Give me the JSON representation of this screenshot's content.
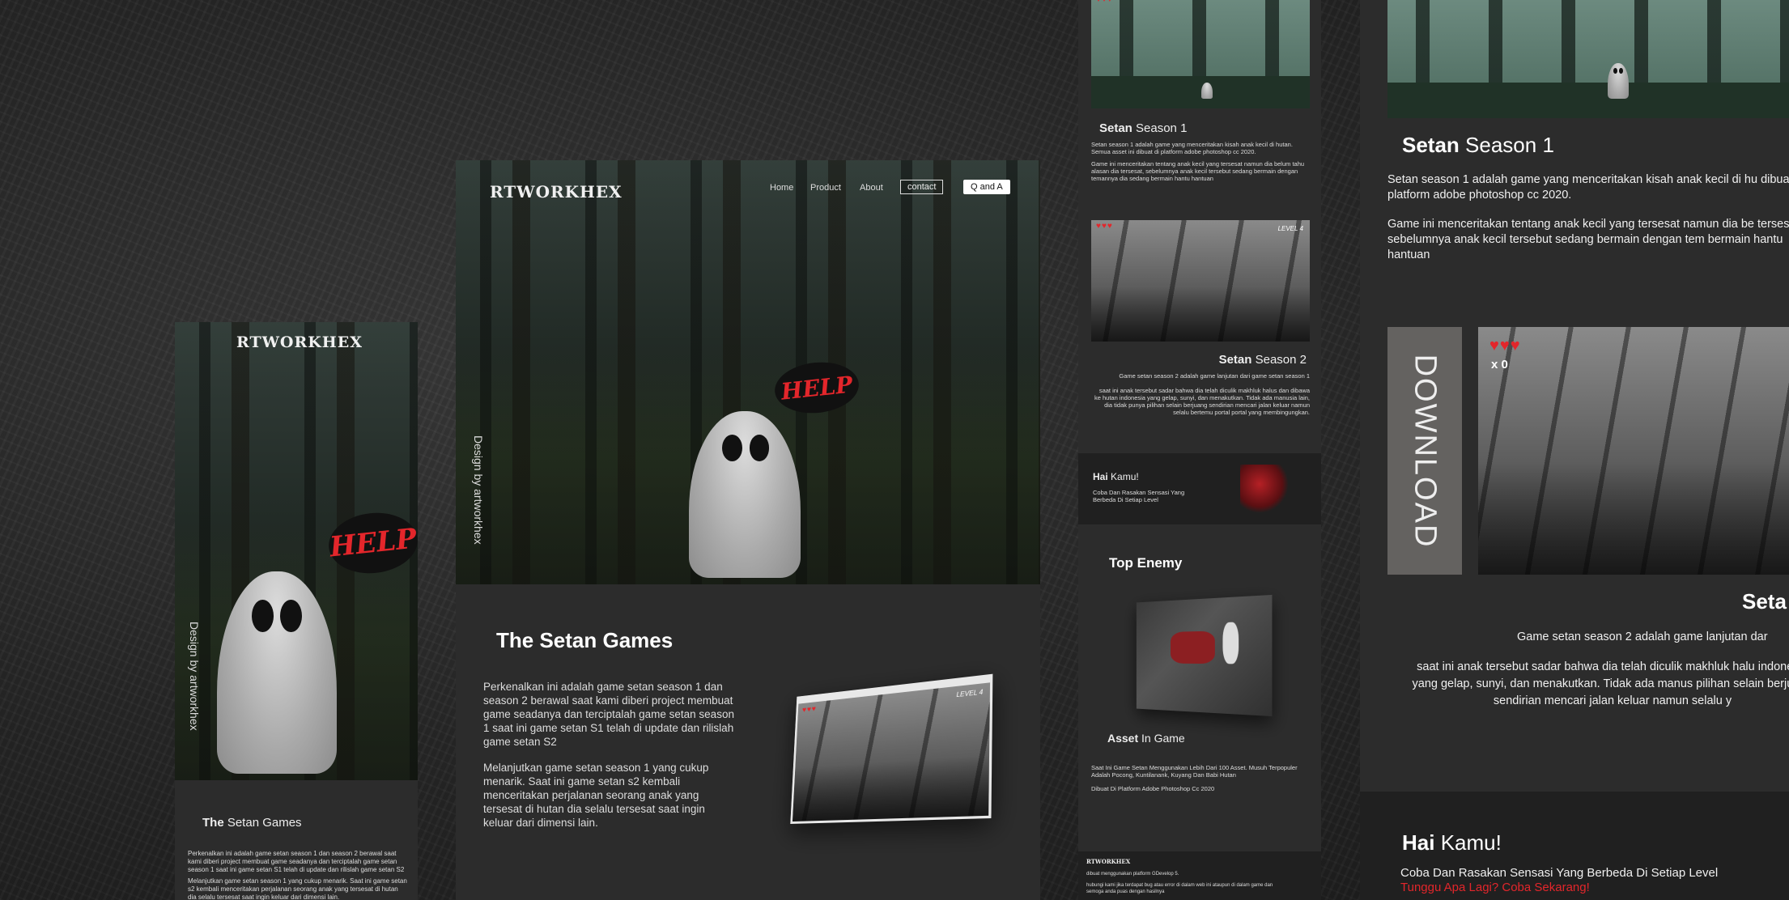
{
  "brand": {
    "logo_desktop": "RTWORKHEX",
    "logo_mobile": "RTWORKHEX",
    "logo_footer": "RTWORKHEX"
  },
  "nav": {
    "home": "Home",
    "product": "Product",
    "about": "About",
    "contact": "contact",
    "qa": "Q and A"
  },
  "hero": {
    "side_credit": "Design by artworkhex",
    "speech": "HELP"
  },
  "intro": {
    "title_bold": "The",
    "title_rest": " Setan Games",
    "title_full": "The Setan Games",
    "para1": "Perkenalkan ini adalah game setan season 1 dan season 2 berawal saat kami diberi project membuat game seadanya dan terciptalah game setan season 1 saat ini game setan S1 telah di update dan rilislah game setan S2",
    "para2": "Melanjutkan game setan season 1 yang cukup menarik. Saat ini game setan s2 kembali menceritakan perjalanan seorang anak yang tersesat di hutan dia selalu tersesat saat ingin keluar dari dimensi lain.",
    "mobile_para1": "Perkenalkan ini adalah game setan season 1 dan season 2 berawal saat kami diberi project membuat game seadanya dan terciptalah game setan season 1 saat ini game setan S1 telah di update dan rilislah game setan S2",
    "mobile_para2": "Melanjutkan game setan season 1 yang cukup menarik. Saat ini game setan s2 kembali menceritakan perjalanan seorang anak yang tersesat di hutan dia selalu tersesat saat ingin keluar dari dimensi lain."
  },
  "game_hud": {
    "level": "LEVEL 4",
    "lives": "♥♥♥",
    "counter": "x 0"
  },
  "season1": {
    "title_bold": "Setan",
    "title_rest": " Season 1",
    "desc1": "Setan season 1 adalah game yang menceritakan kisah anak kecil di hutan. Semua asset ini dibuat di platform adobe photoshop cc 2020.",
    "desc2": "Game ini menceritakan tentang anak kecil yang tersesat namun dia belum tahu alasan dia tersesat, sebelumnya anak kecil tersebut sedang bermain dengan temannya dia sedang bermain hantu hantuan",
    "big_desc1": "Setan season 1 adalah game yang menceritakan kisah anak kecil di hu dibuat di platform adobe photoshop cc 2020.",
    "big_desc2": "Game ini menceritakan tentang anak kecil yang tersesat namun dia be tersesat, sebelumnya anak kecil tersebut sedang bermain dengan tem bermain hantu hantuan"
  },
  "season2": {
    "title_bold": "Setan",
    "title_rest": " Season 2",
    "big_title": "Seta",
    "desc1": "Game setan season 2 adalah game lanjutan dari game setan season 1",
    "desc2": "saat ini anak tersebut sadar bahwa dia telah diculik makhluk halus dan dibawa ke hutan indonesia yang gelap, sunyi, dan menakutkan. Tidak ada manusia lain, dia tidak punya pilihan selain berjuang sendirian mencari jalan keluar namun selalu bertemu portal portal yang membingungkan.",
    "big_desc1": "Game setan season 2 adalah game lanjutan dar",
    "big_desc2": "saat ini anak tersebut sadar bahwa dia telah diculik makhluk halu indonesia yang gelap, sunyi, dan menakutkan. Tidak ada manus pilihan selain berjuang sendirian mencari jalan keluar namun selalu y",
    "download": "DOWNLOAD"
  },
  "hai": {
    "bold": "Hai",
    "rest": " Kamu!",
    "small_line": "Coba Dan Rasakan Sensasi Yang Berbeda Di Setiap Level",
    "big_line": "Coba Dan Rasakan Sensasi Yang Berbeda Di Setiap Level",
    "cta": "Tunggu Apa Lagi? Coba Sekarang!"
  },
  "enemy": {
    "title": "Top Enemy",
    "asset_bold": "Asset",
    "asset_rest": " In Game",
    "desc1": "Saat Ini Game Setan Menggunakan Lebih Dari 100 Asset.  Musuh Terpopuler Adalah Pocong, Kuntilanank, Kuyang Dan Babi  Hutan",
    "desc2": "Dibuat Di Platform Adobe Photoshop Cc 2020"
  },
  "footer": {
    "line1": "dibuat menggunakan platform GDevelop 5.",
    "line2": "hubungi kami jika terdapat bug atau error di dalam web ini ataupun di dalam game dan semoga anda puas dengan hasilnya"
  },
  "colors": {
    "accent_red": "#e3262b",
    "panel": "#2c2c2c",
    "dark": "#202020"
  }
}
